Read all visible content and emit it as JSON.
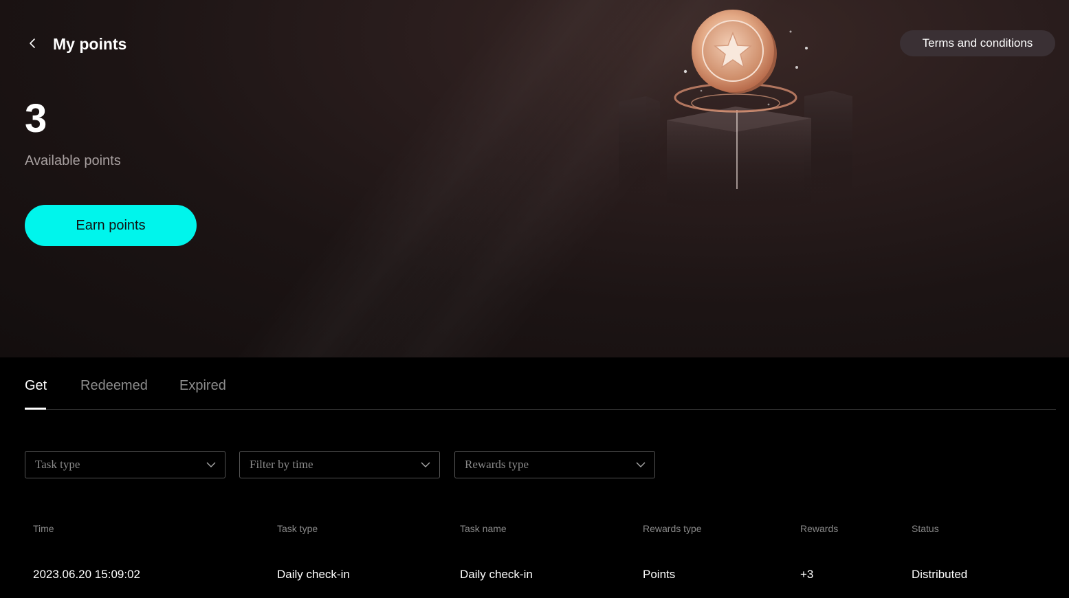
{
  "header": {
    "title": "My points",
    "back_icon": "chevron-left-icon",
    "terms_label": "Terms and conditions"
  },
  "summary": {
    "points": "3",
    "points_label": "Available points",
    "earn_label": "Earn points"
  },
  "tabs": [
    {
      "label": "Get",
      "active": true
    },
    {
      "label": "Redeemed",
      "active": false
    },
    {
      "label": "Expired",
      "active": false
    }
  ],
  "filters": [
    {
      "placeholder": "Task type",
      "icon": "chevron-down-icon"
    },
    {
      "placeholder": "Filter by time",
      "icon": "chevron-down-icon"
    },
    {
      "placeholder": "Rewards type",
      "icon": "chevron-down-icon"
    }
  ],
  "table": {
    "columns": [
      "Time",
      "Task type",
      "Task name",
      "Rewards type",
      "Rewards",
      "Status"
    ],
    "rows": [
      [
        "2023.06.20 15:09:02",
        "Daily check-in",
        "Daily check-in",
        "Points",
        "+3",
        "Distributed"
      ]
    ]
  },
  "colors": {
    "accent": "#00f5ec",
    "hero_bg": "#1c1414",
    "page_bg": "#000000",
    "coin": "#e8b090"
  }
}
